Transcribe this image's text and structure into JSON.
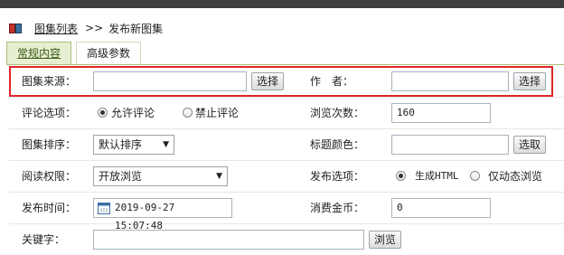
{
  "breadcrumb": {
    "link": "图集列表",
    "separator": ">>",
    "current": "发布新图集"
  },
  "tabs": [
    {
      "label": "常规内容",
      "active": true
    },
    {
      "label": "高级参数",
      "active": false
    }
  ],
  "form": {
    "source": {
      "label": "图集来源：",
      "value": "",
      "button": "选择"
    },
    "author": {
      "label": "作　者：",
      "value": "",
      "button": "选择"
    },
    "comment": {
      "label": "评论选项：",
      "options": [
        "允许评论",
        "禁止评论"
      ],
      "selected": "允许评论"
    },
    "views": {
      "label": "浏览次数：",
      "value": "160"
    },
    "sort": {
      "label": "图集排序：",
      "value": "默认排序"
    },
    "title_color": {
      "label": "标题颜色：",
      "value": "",
      "button": "选取"
    },
    "read_perm": {
      "label": "阅读权限：",
      "value": "开放浏览"
    },
    "publish_opt": {
      "label": "发布选项：",
      "options": [
        "生成HTML",
        "仅动态浏览"
      ],
      "selected": "生成HTML"
    },
    "publish_time": {
      "label": "发布时间：",
      "value": "2019-09-27 15:07:48"
    },
    "coins": {
      "label": "消费金币：",
      "value": "0"
    },
    "partial_row": {
      "label": "关键字：",
      "button": "浏览"
    }
  }
}
